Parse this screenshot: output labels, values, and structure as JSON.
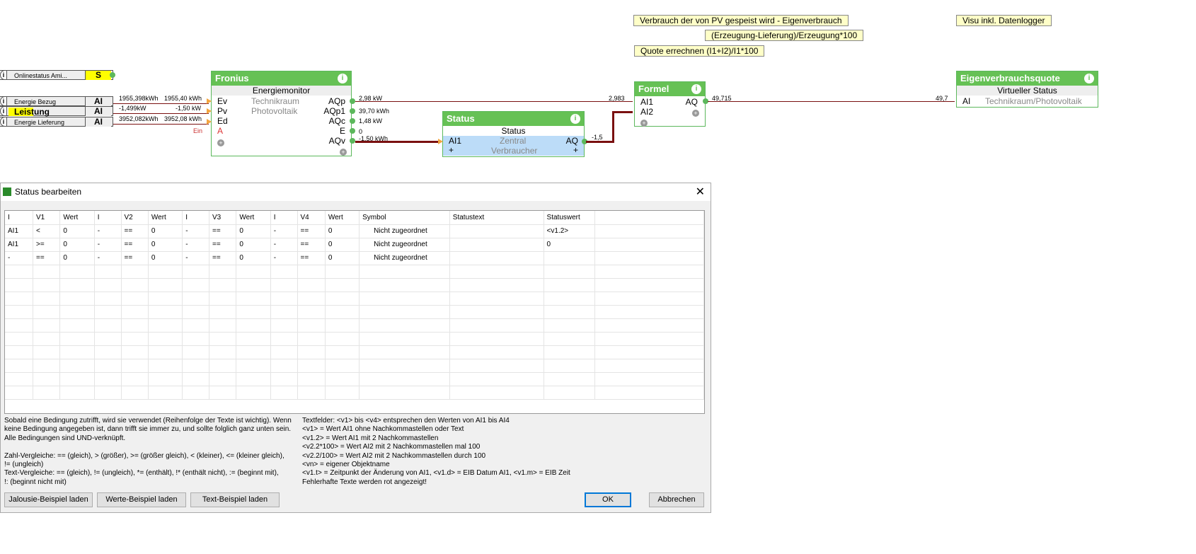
{
  "notes": [
    "Verbrauch der von PV gespeist wird - Eigenverbrauch",
    "(Erzeugung-Lieferung)/Erzeugung*100",
    "Quote errechnen (I1+I2)/I1*100",
    "Visu inkl. Datenlogger"
  ],
  "inputs": [
    {
      "label": "Onlinestatus Ami...",
      "type": "S"
    },
    {
      "label": "Energie Bezug",
      "type": "AI",
      "v1": "1955,398kWh",
      "v2": "1955,40 kWh"
    },
    {
      "label": "Leistung",
      "type": "AI",
      "v1": "-1,499kW",
      "v2": "-1,50 kW"
    },
    {
      "label": "Energie Lieferung",
      "type": "AI",
      "v1": "3952,082kWh",
      "v2": "3952,08 kWh"
    }
  ],
  "fronius": {
    "title": "Fronius",
    "sub": "Energiemonitor",
    "line1": "Technikraum",
    "line2": "Photovoltaik",
    "inputs": [
      "Ev",
      "Pv",
      "Ed",
      "A"
    ],
    "ein": "Ein",
    "outputs": [
      "AQp",
      "AQp1",
      "AQc",
      "E",
      "AQv"
    ],
    "out_values": [
      "2,98 kW",
      "39,70 kWh",
      "1,48 kW",
      "0",
      "-1,50 kWh"
    ]
  },
  "status_block": {
    "title": "Status",
    "sub": "Status",
    "in": "AI1",
    "out": "AQ",
    "line1": "Zentral",
    "line2": "Verbraucher",
    "out_value": "-1,5"
  },
  "formel": {
    "title": "Formel",
    "in1": "AI1",
    "in2": "AI2",
    "out": "AQ",
    "in1_value": "2,983",
    "out_value": "49,715"
  },
  "quote": {
    "title": "Eigenverbrauchsquote",
    "sub": "Virtueller Status",
    "in": "AI",
    "line": "Technikraum/Photovoltaik",
    "in_value": "49,7"
  },
  "dialog": {
    "title": "Status bearbeiten",
    "columns": [
      "I",
      "V1",
      "Wert",
      "I",
      "V2",
      "Wert",
      "I",
      "V3",
      "Wert",
      "I",
      "V4",
      "Wert",
      "Symbol",
      "Statustext",
      "Statuswert"
    ],
    "rows": [
      [
        "AI1",
        "<",
        "0",
        "-",
        "==",
        "0",
        "-",
        "==",
        "0",
        "-",
        "==",
        "0",
        "Nicht zugeordnet",
        "",
        "<v1.2>"
      ],
      [
        "AI1",
        ">=",
        "0",
        "-",
        "==",
        "0",
        "-",
        "==",
        "0",
        "-",
        "==",
        "0",
        "Nicht zugeordnet",
        "",
        "0"
      ],
      [
        "-",
        "==",
        "0",
        "-",
        "==",
        "0",
        "-",
        "==",
        "0",
        "-",
        "==",
        "0",
        "Nicht zugeordnet",
        "",
        ""
      ]
    ],
    "help_left": "Sobald eine Bedingung zutrifft, wird sie verwendet (Reihenfolge der Texte ist wichtig). Wenn\nkeine Bedingung angegeben ist, dann trifft sie immer zu, und sollte folglich ganz unten sein.\nAlle Bedingungen sind UND-verknüpft.\n\nZahl-Vergleiche: == (gleich), > (größer), >= (größer gleich), < (kleiner), <= (kleiner gleich),\n!= (ungleich)\nText-Vergleiche: == (gleich), != (ungleich), *= (enthält), !* (enthält nicht), := (beginnt mit),\n!: (beginnt nicht mit)",
    "help_right": "Textfelder: <v1> bis <v4> entsprechen den Werten von AI1 bis AI4\n<v1> = Wert AI1 ohne Nachkommastellen oder Text\n<v1.2> = Wert AI1 mit 2 Nachkommastellen\n<v2.2*100> = Wert AI2 mit 2 Nachkommastellen mal 100\n<v2.2/100> = Wert AI2 mit 2 Nachkommastellen durch 100\n<vn> = eigener Objektname\n<v1.t> = Zeitpunkt der Änderung von AI1, <v1.d> = EIB Datum AI1, <v1.m> = EIB Zeit\nFehlerhafte Texte werden rot angezeigt!",
    "buttons": {
      "jalousie": "Jalousie-Beispiel laden",
      "werte": "Werte-Beispiel laden",
      "text": "Text-Beispiel laden",
      "ok": "OK",
      "cancel": "Abbrechen"
    }
  }
}
